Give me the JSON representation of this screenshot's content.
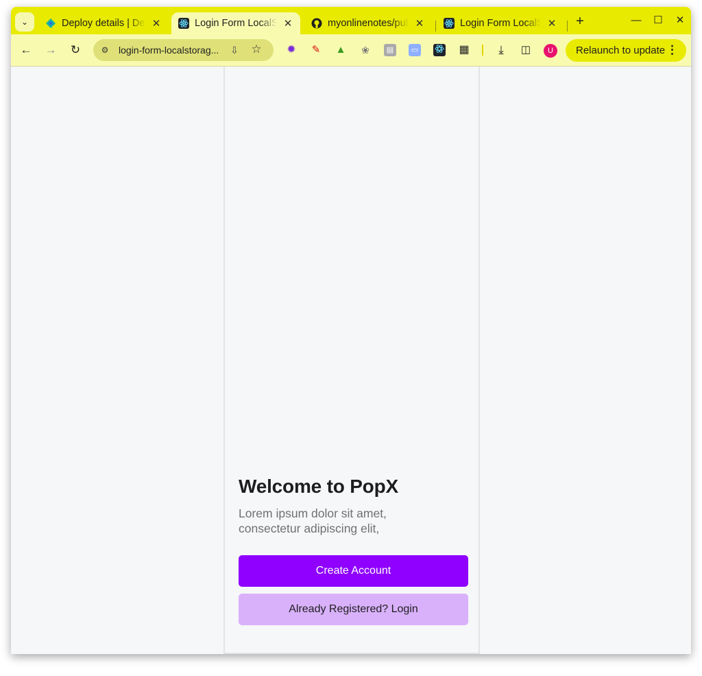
{
  "browser": {
    "tabs": [
      {
        "title": "Deploy details | Deploys",
        "favicon": "netlify-icon",
        "active": false
      },
      {
        "title": "Login Form LocalStorage",
        "favicon": "react-icon",
        "active": true
      },
      {
        "title": "myonlinenotes/public",
        "favicon": "github-icon",
        "active": false
      },
      {
        "title": "Login Form LocalStorage",
        "favicon": "react-icon",
        "active": false
      }
    ],
    "new_tab_label": "+",
    "address_bar": {
      "url": "login-form-localstorag..."
    },
    "relaunch_label": "Relaunch to update",
    "avatar_initial": "U",
    "colors": {
      "frame": "#e8ea00",
      "toolbar": "#f8fab0",
      "omnibox": "#dfe178"
    }
  },
  "app": {
    "title": "Welcome to PopX",
    "description": "Lorem ipsum dolor sit amet, consectetur adipiscing elit,",
    "primary_button": "Create Account",
    "secondary_button": "Already Registered? Login",
    "colors": {
      "primary": "#8f00ff",
      "secondary": "#d9b1fa",
      "background": "#f6f7f9"
    }
  }
}
